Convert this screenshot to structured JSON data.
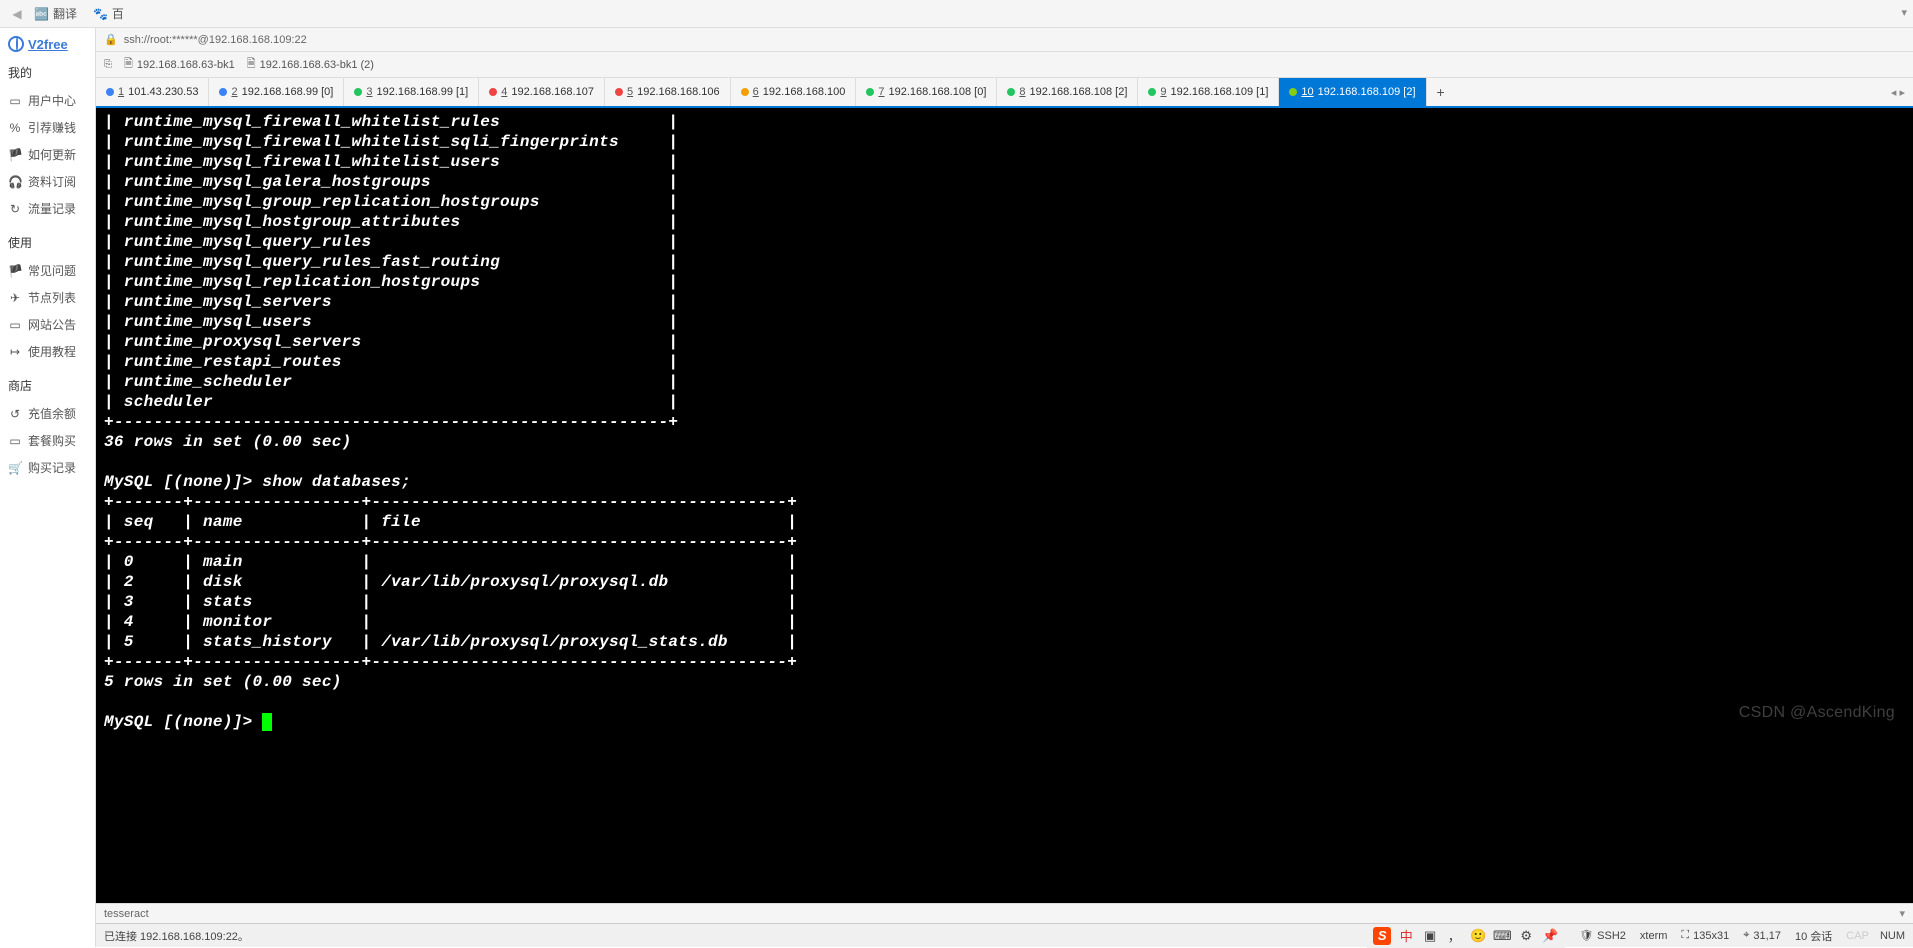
{
  "browser": {
    "translate": "翻译",
    "baidu": "百"
  },
  "sidebar": {
    "logo": "V2free",
    "sections": [
      {
        "heading": "我的",
        "items": [
          {
            "icon": "▭",
            "label": "用户中心"
          },
          {
            "icon": "%",
            "label": "引荐赚钱"
          },
          {
            "icon": "🏴",
            "label": "如何更新"
          },
          {
            "icon": "🎧",
            "label": "资料订阅"
          },
          {
            "icon": "↻",
            "label": "流量记录"
          }
        ]
      },
      {
        "heading": "使用",
        "items": [
          {
            "icon": "🏴",
            "label": "常见问题"
          },
          {
            "icon": "✈",
            "label": "节点列表"
          },
          {
            "icon": "▭",
            "label": "网站公告"
          },
          {
            "icon": "↦",
            "label": "使用教程"
          }
        ]
      },
      {
        "heading": "商店",
        "items": [
          {
            "icon": "↺",
            "label": "充值余额"
          },
          {
            "icon": "▭",
            "label": "套餐购买"
          },
          {
            "icon": "🛒",
            "label": "购买记录"
          }
        ]
      }
    ]
  },
  "ssh_title": "ssh://root:******@192.168.168.109:22",
  "file_tabs": [
    {
      "label": "192.168.168.63-bk1"
    },
    {
      "label": "192.168.168.63-bk1 (2)"
    }
  ],
  "session_tabs": [
    {
      "num": "1",
      "dot": "blue",
      "label": "101.43.230.53"
    },
    {
      "num": "2",
      "dot": "blue",
      "label": "192.168.168.99 [0]"
    },
    {
      "num": "3",
      "dot": "green",
      "label": "192.168.168.99 [1]"
    },
    {
      "num": "4",
      "dot": "red",
      "label": "192.168.168.107"
    },
    {
      "num": "5",
      "dot": "red",
      "label": "192.168.168.106"
    },
    {
      "num": "6",
      "dot": "orange",
      "label": "192.168.168.100"
    },
    {
      "num": "7",
      "dot": "green",
      "label": "192.168.168.108 [0]"
    },
    {
      "num": "8",
      "dot": "green",
      "label": "192.168.168.108 [2]"
    },
    {
      "num": "9",
      "dot": "green",
      "label": "192.168.168.109 [1]"
    },
    {
      "num": "10",
      "dot": "lime",
      "label": "192.168.168.109 [2]",
      "active": true
    }
  ],
  "terminal": {
    "tables": [
      "runtime_mysql_firewall_whitelist_rules",
      "runtime_mysql_firewall_whitelist_sqli_fingerprints",
      "runtime_mysql_firewall_whitelist_users",
      "runtime_mysql_galera_hostgroups",
      "runtime_mysql_group_replication_hostgroups",
      "runtime_mysql_hostgroup_attributes",
      "runtime_mysql_query_rules",
      "runtime_mysql_query_rules_fast_routing",
      "runtime_mysql_replication_hostgroups",
      "runtime_mysql_servers",
      "runtime_mysql_users",
      "runtime_proxysql_servers",
      "runtime_restapi_routes",
      "runtime_scheduler",
      "scheduler"
    ],
    "rows_summary_1": "36 rows in set (0.00 sec)",
    "prompt1": "MySQL [(none)]> ",
    "cmd1": "show databases;",
    "db_header": {
      "seq": "seq",
      "name": "name",
      "file": "file"
    },
    "databases": [
      {
        "seq": "0",
        "name": "main",
        "file": ""
      },
      {
        "seq": "2",
        "name": "disk",
        "file": "/var/lib/proxysql/proxysql.db"
      },
      {
        "seq": "3",
        "name": "stats",
        "file": ""
      },
      {
        "seq": "4",
        "name": "monitor",
        "file": ""
      },
      {
        "seq": "5",
        "name": "stats_history",
        "file": "/var/lib/proxysql/proxysql_stats.db"
      }
    ],
    "rows_summary_2": "5 rows in set (0.00 sec)",
    "prompt2": "MySQL [(none)]> "
  },
  "watermark": "CSDN @AscendKing",
  "bottom_info": "tesseract",
  "status": {
    "connected": "已连接 192.168.168.109:22。",
    "ssh2": "SSH2",
    "xterm": "xterm",
    "size": "135x31",
    "cursor": "31,17",
    "sessions": "10 会话",
    "caps": "NUM"
  },
  "tray": {
    "cn": "中",
    "full": "▣"
  }
}
